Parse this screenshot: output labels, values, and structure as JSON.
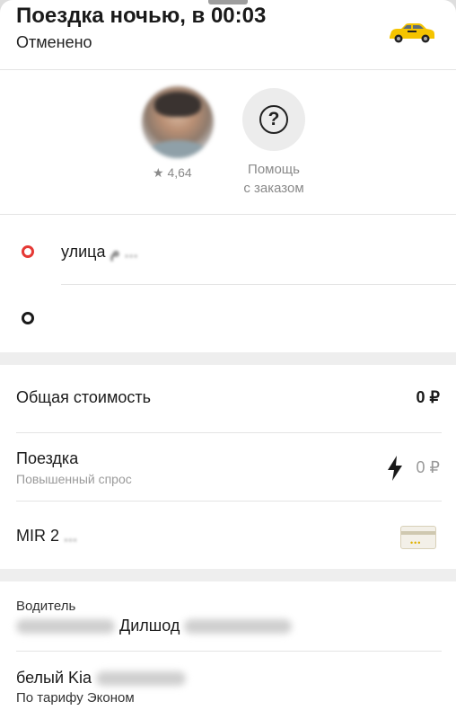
{
  "header": {
    "title": "Поездка ночью, в 00:03",
    "status": "Отменено",
    "car_icon": "taxi-car-icon"
  },
  "driver_summary": {
    "rating_star": "★",
    "rating": "4,64",
    "help_icon": "question-icon",
    "help_label_line1": "Помощь",
    "help_label_line2": "с заказом"
  },
  "route": {
    "from": "улица",
    "from_blurred": "م ..."
  },
  "cost": {
    "total_label": "Общая стоимость",
    "total_value": "0 ₽",
    "trip_label": "Поездка",
    "trip_sub": "Повышенный спрос",
    "trip_icon": "lightning-icon",
    "trip_value": "0 ₽",
    "payment_label": "MIR 2",
    "payment_blurred": "...",
    "card_icon": "card-icon",
    "card_dots": "•••",
    "accent_color": "#f5c400"
  },
  "driver": {
    "heading": "Водитель",
    "name": "Дилшод"
  },
  "car": {
    "model": "белый Kia",
    "tariff": "По тарифу Эконом"
  },
  "colors": {
    "origin_dot": "#e53935",
    "destination_dot": "#1a1a1a",
    "taxi_yellow": "#f5c400"
  }
}
